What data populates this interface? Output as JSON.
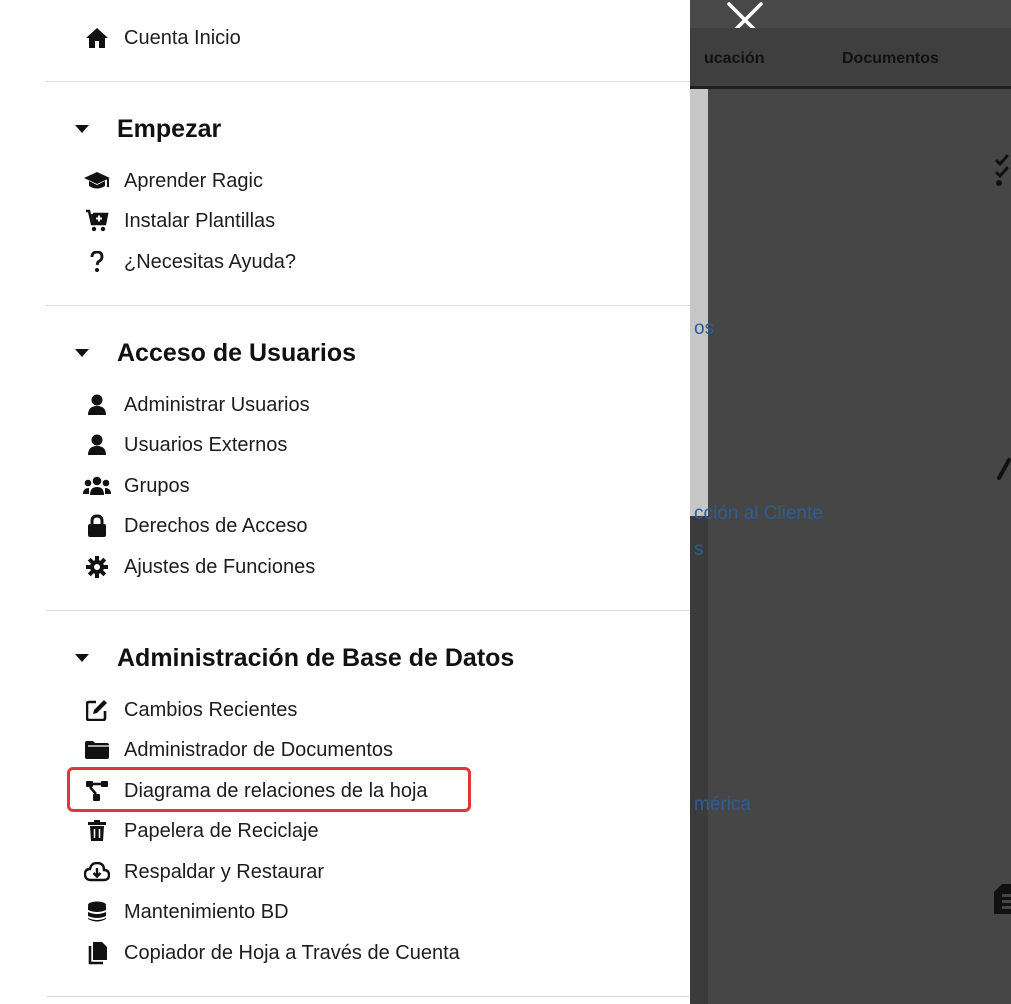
{
  "drawer": {
    "home": {
      "label": "Cuenta Inicio",
      "icon": "home-icon"
    },
    "sections": [
      {
        "title": "Empezar",
        "items": [
          {
            "label": "Aprender Ragic",
            "icon": "graduation-cap-icon"
          },
          {
            "label": "Instalar Plantillas",
            "icon": "cart-plus-icon"
          },
          {
            "label": "¿Necesitas Ayuda?",
            "icon": "question-icon"
          }
        ]
      },
      {
        "title": "Acceso de Usuarios",
        "items": [
          {
            "label": "Administrar Usuarios",
            "icon": "user-icon"
          },
          {
            "label": "Usuarios Externos",
            "icon": "user-icon"
          },
          {
            "label": "Grupos",
            "icon": "users-icon"
          },
          {
            "label": "Derechos de Acceso",
            "icon": "lock-icon"
          },
          {
            "label": "Ajustes de Funciones",
            "icon": "gear-icon"
          }
        ]
      },
      {
        "title": "Administración de Base de Datos",
        "items": [
          {
            "label": "Cambios Recientes",
            "icon": "edit-icon"
          },
          {
            "label": "Administrador de Documentos",
            "icon": "folder-icon"
          },
          {
            "label": "Diagrama de relaciones de la hoja",
            "icon": "diagram-icon",
            "highlighted": true
          },
          {
            "label": "Papelera de Reciclaje",
            "icon": "trash-icon"
          },
          {
            "label": "Respaldar y Restaurar",
            "icon": "cloud-download-icon"
          },
          {
            "label": "Mantenimiento BD",
            "icon": "database-icon"
          },
          {
            "label": "Copiador de Hoja a Través de Cuenta",
            "icon": "copy-icon"
          }
        ]
      }
    ]
  },
  "background": {
    "tabs": [
      "ucación",
      "Documentos"
    ],
    "links": [
      "os",
      "cción al Cliente",
      "s",
      "mérica"
    ],
    "highlight_color": "#e0353b",
    "link_color": "#2f5c93"
  }
}
